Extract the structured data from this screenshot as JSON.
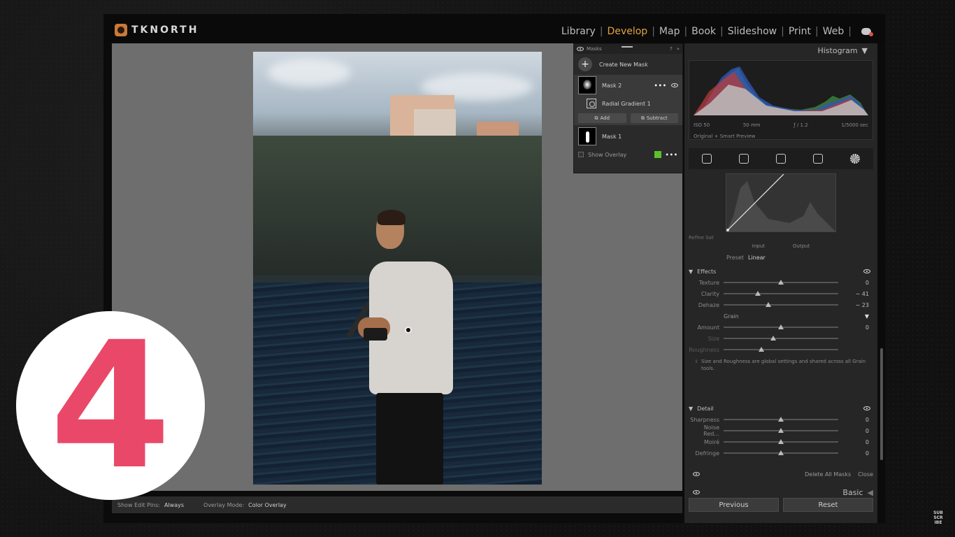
{
  "brand": {
    "name": "TKNORTH"
  },
  "modules": [
    "Library",
    "Develop",
    "Map",
    "Book",
    "Slideshow",
    "Print",
    "Web"
  ],
  "active_module": "Develop",
  "mask_panel": {
    "title": "Masks",
    "create_label": "Create New Mask",
    "mask2_label": "Mask 2",
    "component_label": "Radial Gradient 1",
    "add_label": "Add",
    "subtract_label": "Subtract",
    "mask1_label": "Mask 1",
    "show_overlay_label": "Show Overlay",
    "overlay_color": "#5bbf2e"
  },
  "histogram": {
    "title": "Histogram",
    "iso": "ISO 50",
    "focal": "50 mm",
    "aperture": "ƒ / 1.2",
    "shutter": "1/5000 sec",
    "preview": "Original + Smart Preview"
  },
  "curve": {
    "refine_label": "Refine Sat",
    "input_label": "Input",
    "output_label": "Output",
    "preset_label": "Preset",
    "preset_value": "Linear"
  },
  "effects": {
    "title": "Effects",
    "sliders": [
      {
        "label": "Texture",
        "value": "0",
        "pos": 0.5
      },
      {
        "label": "Clarity",
        "value": "− 41",
        "pos": 0.3
      },
      {
        "label": "Dehaze",
        "value": "− 23",
        "pos": 0.39
      }
    ],
    "grain_title": "Grain",
    "grain_sliders": [
      {
        "label": "Amount",
        "value": "0",
        "pos": 0.5
      },
      {
        "label": "Size",
        "value": "",
        "pos": 0.43
      },
      {
        "label": "Roughness",
        "value": "",
        "pos": 0.33
      }
    ],
    "note": "Size and Roughness are global settings and shared across all Grain tools."
  },
  "detail": {
    "title": "Detail",
    "sliders": [
      {
        "label": "Sharpness",
        "value": "0",
        "pos": 0.5
      },
      {
        "label": "Noise Red...",
        "value": "0",
        "pos": 0.5
      },
      {
        "label": "Moiré",
        "value": "0",
        "pos": 0.5
      },
      {
        "label": "Defringe",
        "value": "0",
        "pos": 0.5
      }
    ]
  },
  "footer": {
    "delete_all": "Delete All Masks",
    "close": "Close",
    "basic": "Basic",
    "previous": "Previous",
    "reset": "Reset"
  },
  "toolbar": {
    "edit_pins_label": "Show Edit Pins:",
    "edit_pins_value": "Always",
    "overlay_mode_label": "Overlay Mode:",
    "overlay_mode_value": "Color Overlay"
  },
  "badge": {
    "number": "4",
    "color": "#ea4868"
  },
  "subscribe": [
    "SUB",
    "SCR",
    "IBE"
  ]
}
